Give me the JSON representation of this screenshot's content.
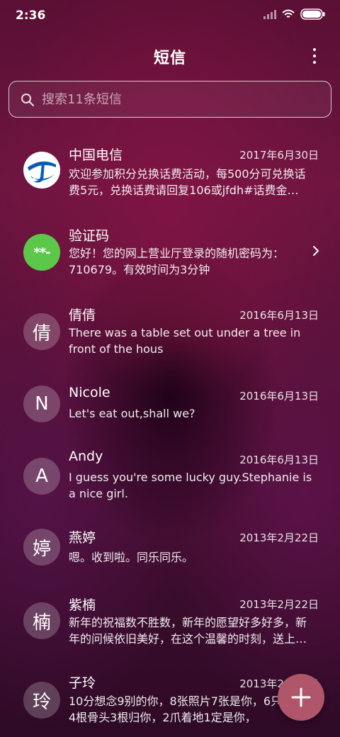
{
  "status_bar": {
    "time": "2:36"
  },
  "header": {
    "title": "短信"
  },
  "search": {
    "placeholder": "搜索11条短信"
  },
  "conversations": [
    {
      "name": "中国电信",
      "date": "2017年6月30日",
      "preview": "欢迎参加积分兑换话费活动，每500分可兑换话费5元，兑换话费请回复106或jfdh#话费金…",
      "avatar_type": "telecom-logo"
    },
    {
      "name": "验证码",
      "date": "",
      "preview": "您好！您的网上营业厅登录的随机密码为：710679。有效时间为3分钟",
      "avatar_text": "**-",
      "avatar_color": "#5cc84a"
    },
    {
      "name": "倩倩",
      "date": "2016年6月13日",
      "preview": "There was a table set out under a tree in front of the hous",
      "avatar_text": "倩"
    },
    {
      "name": "Nicole",
      "date": "2016年6月13日",
      "preview": "Let's eat out,shall we?",
      "avatar_text": "N"
    },
    {
      "name": "Andy",
      "date": "2016年6月13日",
      "preview": "I guess you're some lucky guy.Stephanie is a nice girl.",
      "avatar_text": "A"
    },
    {
      "name": "燕婷",
      "date": "2013年2月22日",
      "preview": "嗯。收到啦。同乐同乐。",
      "avatar_text": "婷"
    },
    {
      "name": "紫楠",
      "date": "2013年2月22日",
      "preview": "新年的祝福数不胜数，新年的愿望好多好多，新年的问候依旧美好，在这个温馨的时刻，送上…",
      "avatar_text": "楠"
    },
    {
      "name": "子玲",
      "date": "2013年2月22日",
      "preview": "10分想念9别的你，8张照片7张是你，6只像你，4根骨头3根归你，2爪着地1定是你，",
      "avatar_text": "玲"
    }
  ],
  "colors": {
    "fab": "#b0566a",
    "accent_green": "#5cc84a",
    "telecom_blue": "#0a5bb5"
  },
  "icons": {
    "search": "search-icon",
    "more": "more-vertical-icon",
    "compose": "plus-icon",
    "chevron": "chevron-right-icon"
  }
}
